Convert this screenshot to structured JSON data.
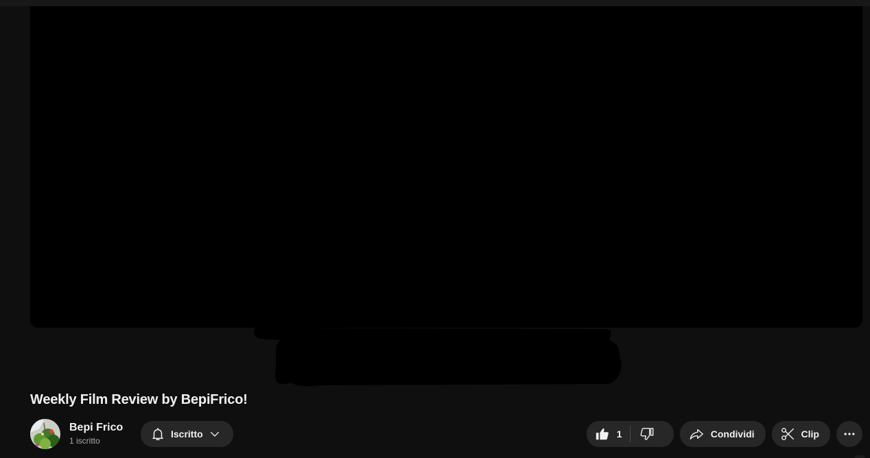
{
  "video": {
    "title": "Weekly Film Review by BepiFrico!"
  },
  "channel": {
    "name": "Bepi Frico",
    "subscribers": "1 iscritto",
    "subscribe_label": "Iscritto"
  },
  "actions": {
    "like_count": "1",
    "share_label": "Condividi",
    "clip_label": "Clip"
  },
  "icons": {
    "bell": "bell-icon",
    "chevron": "chevron-down-icon",
    "like": "thumbs-up-icon",
    "dislike": "thumbs-down-icon",
    "share": "share-arrow-icon",
    "clip": "scissors-icon",
    "more": "more-horizontal-icon"
  },
  "colors": {
    "background": "#0f0f0f",
    "pill": "#272727",
    "text": "#f1f1f1",
    "secondary_text": "#aaaaaa"
  }
}
